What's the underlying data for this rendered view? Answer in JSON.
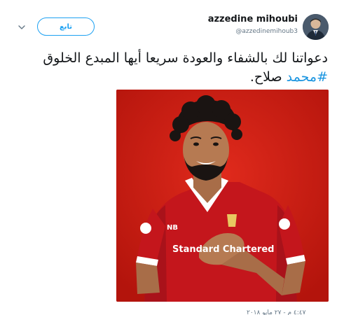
{
  "user": {
    "display_name": "azzedine mihoubi",
    "handle": "@azzedinemihoub3"
  },
  "follow_button": {
    "label": "تابع"
  },
  "tweet": {
    "text_before_hashtag": "دعواتنا لك بالشفاء والعودة سريعا أيها المبدع الخلوق ",
    "hashtag": "#محمد",
    "text_after_hashtag": " صلاح."
  },
  "photo": {
    "background_color": "#cc1c12",
    "jersey_color": "#c4161c",
    "jersey_sponsor": "Standard Chartered",
    "jersey_brand": "NB"
  },
  "timestamp": "٤:٤٧ م - ٢٧ مايو ٢٠١٨"
}
